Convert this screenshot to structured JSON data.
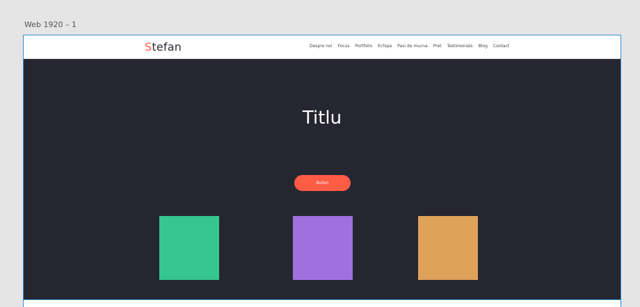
{
  "canvas": {
    "artboard_label": "Web 1920 – 1"
  },
  "header": {
    "logo_first_letter": "S",
    "logo_rest": "tefan",
    "nav_items": [
      "Despre noi",
      "Focus",
      "Portfolio",
      "Echipa",
      "Pasi de mucna",
      "Pret",
      "Testimonials",
      "Blog",
      "Contact"
    ]
  },
  "hero": {
    "title": "Titlu",
    "button_label": "Buton"
  },
  "cards": {
    "colors": [
      "#36c690",
      "#a170df",
      "#dea259"
    ]
  },
  "colors": {
    "accent": "#ff5c45",
    "hero_background": "#262631",
    "selection_border": "#2f8fd8"
  }
}
